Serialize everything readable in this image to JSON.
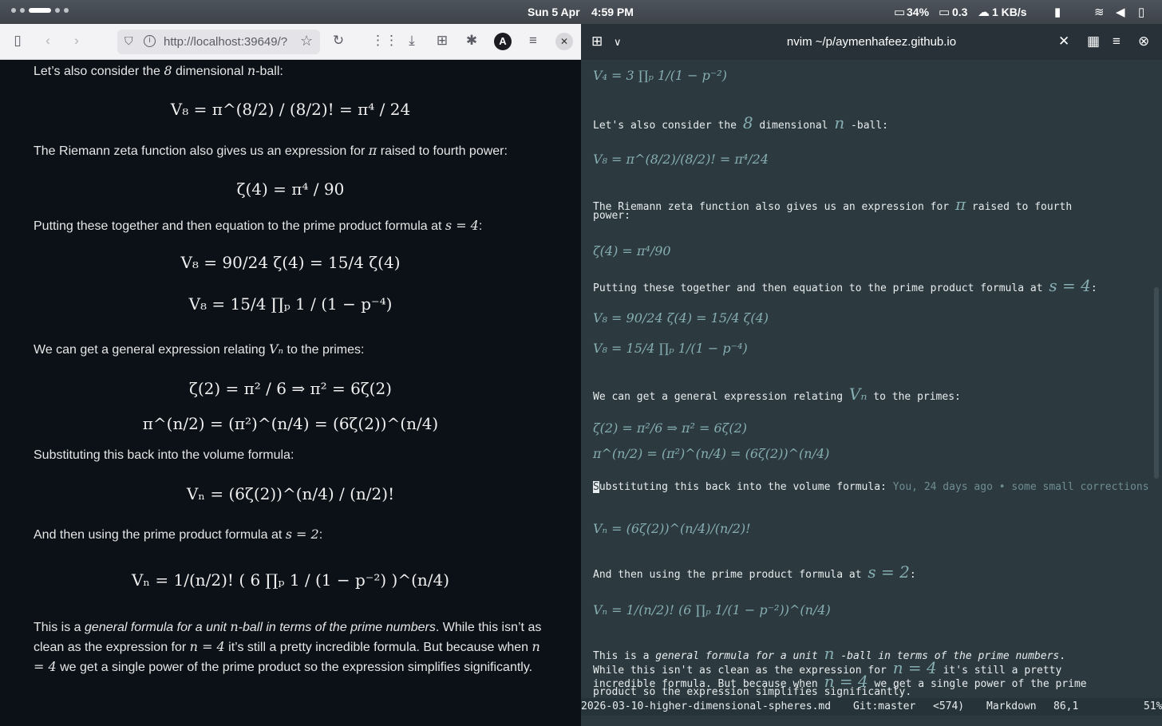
{
  "topbar": {
    "date": "Sun 5 Apr",
    "time": "4:59 PM",
    "battery_pct": "34%",
    "load": "0.3",
    "net": "1 KB/s"
  },
  "browser": {
    "url": "http://localhost:39649/?",
    "avatar": "A"
  },
  "left": {
    "p1a": "Let’s also consider the ",
    "p1b": "8",
    "p1c": " dimensional ",
    "p1d": "n",
    "p1e": "-ball:",
    "eq1": "V₈ = π^(8/2) / (8/2)! = π⁴ / 24",
    "p2a": "The Riemann zeta function also gives us an expression for ",
    "p2b": "π",
    "p2c": " raised to fourth power:",
    "eq2": "ζ(4) = π⁴ / 90",
    "p3a": "Putting these together and then equation to the prime product formula at ",
    "p3b": "s = 4",
    "p3c": ":",
    "eq3": "V₈ = 90/24 ζ(4) = 15/4 ζ(4)",
    "eq4": "V₈ = 15/4 ∏ₚ 1 / (1 − p⁻⁴)",
    "p4a": "We can get a general expression relating ",
    "p4b": "Vₙ",
    "p4c": " to the primes:",
    "eq5": "ζ(2) = π² / 6     ⇒     π² = 6ζ(2)",
    "eq6": "π^(n/2) = (π²)^(n/4) = (6ζ(2))^(n/4)",
    "p5": "Substituting this back into the volume formula:",
    "eq7": "Vₙ = (6ζ(2))^(n/4) / (n/2)!",
    "p6a": "And then using the prime product formula at ",
    "p6b": "s = 2",
    "p6c": ":",
    "eq8": "Vₙ = 1/(n/2)! ( 6 ∏ₚ 1 / (1 − p⁻²) )^(n/4)",
    "p7a": "This is a ",
    "p7b": "general formula for a unit ",
    "p7c": "n",
    "p7d": "-ball in terms of the prime numbers",
    "p7e": ". While this isn’t as clean as the expression for ",
    "p7f": "n = 4",
    "p7g": " it’s still a pretty incredible formula. But because when ",
    "p7h": "n = 4",
    "p7i": " we get a single power of the prime product so the expression simplifies significantly."
  },
  "term": {
    "title": "nvim ~/p/aymenhafeez.github.io"
  },
  "nvim": {
    "eqa": "V₄ = 3 ∏ₚ 1/(1 − p⁻²)",
    "l1a": "Let's also consider the ",
    "l1b": "8",
    "l1c": " dimensional ",
    "l1d": "n",
    "l1e": " -ball:",
    "eqb": "V₈ = π^(8/2)/(8/2)! = π⁴/24",
    "l2a": "The Riemann zeta function also gives us an expression for ",
    "l2b": "π",
    "l2c": " raised to fourth",
    "l2d": "power:",
    "eqc": "ζ(4) = π⁴/90",
    "l3a": "Putting these together and then equation to the prime product formula at ",
    "l3b": "s = 4",
    "l3c": ":",
    "eqd": "V₈ = 90/24 ζ(4) = 15/4 ζ(4)",
    "eqe": "V₈ = 15/4 ∏ₚ 1/(1 − p⁻⁴)",
    "l4a": "We can get a general expression relating ",
    "l4b": "Vₙ",
    "l4c": " to the primes:",
    "eqf": "ζ(2) = π²/6      ⇒      π² = 6ζ(2)",
    "eqg": "π^(n/2) = (π²)^(n/4) = (6ζ(2))^(n/4)",
    "l5cur": "S",
    "l5": "ubstituting this back into the volume formula:",
    "blame": "You, 24 days ago • some small corrections",
    "eqh": "Vₙ = (6ζ(2))^(n/4)/(n/2)!",
    "l6a": "And then using the prime product formula at ",
    "l6b": "s = 2",
    "l6c": ":",
    "eqi": "Vₙ = 1/(n/2)! (6 ∏ₚ 1/(1 − p⁻²))^(n/4)",
    "l7a": "This is a ",
    "l7b": "general formula for a unit ",
    "l7c": "n",
    "l7d": " -ball in terms of the prime numbers",
    "l7e": ".",
    "l8": "While this isn't as clean as the expression for ",
    "l8b": "n = 4",
    "l8c": " it's still a pretty",
    "l9": "incredible formula. But because when ",
    "l9b": "n = 4",
    "l9c": " we get a single power of the prime",
    "l10": "product so the expression simplifies significantly."
  },
  "status": {
    "file": "2026-03-10-higher-dimensional-spheres.md",
    "git": "Git:master",
    "count": "<574)",
    "ft": "Markdown",
    "pos": "86,1",
    "pct": "51%"
  }
}
